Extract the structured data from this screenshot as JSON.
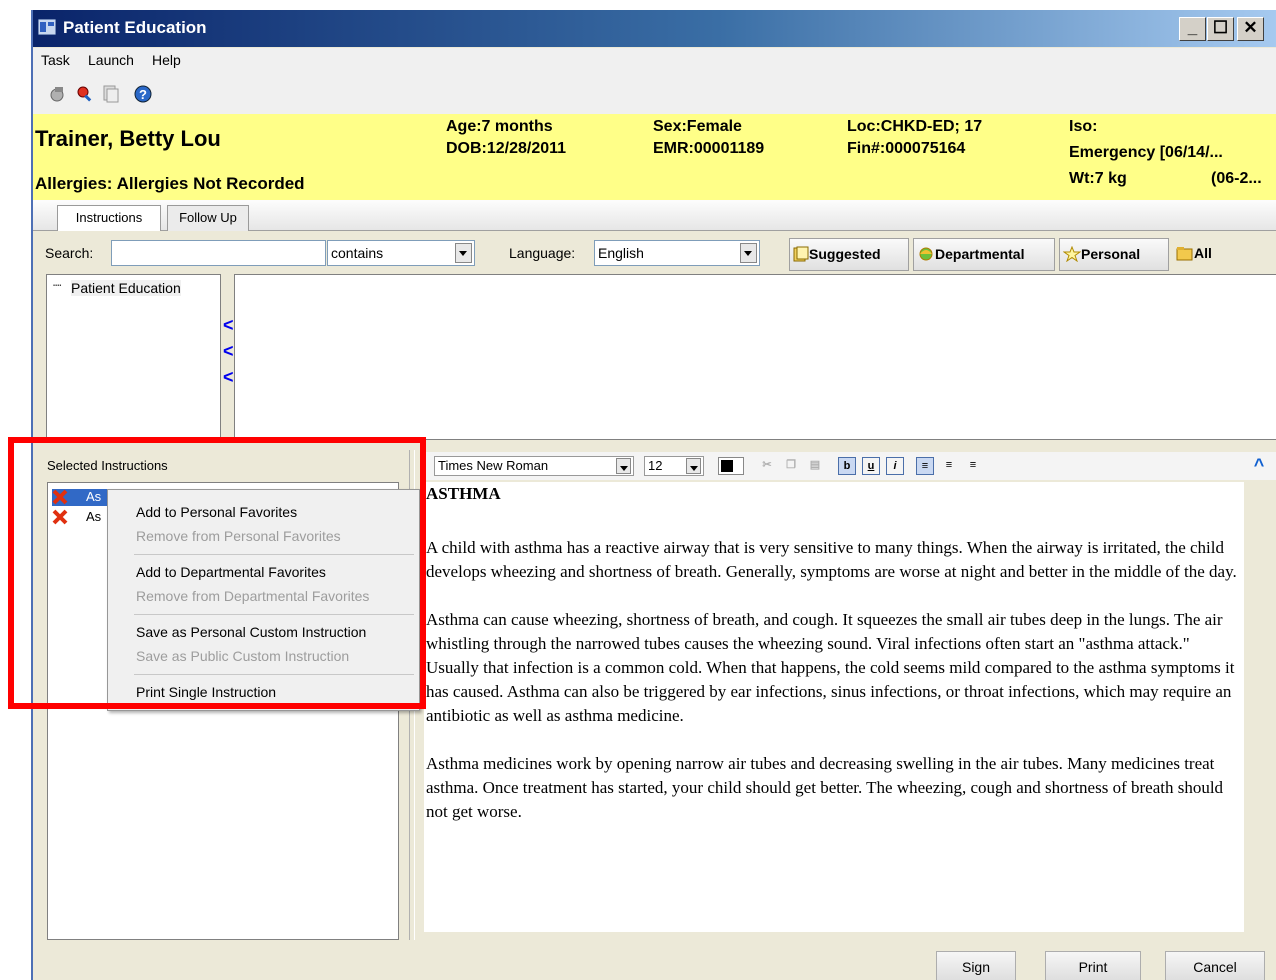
{
  "window": {
    "title": "Patient Education",
    "min_glyph": "_",
    "max_glyph": "☐",
    "close_glyph": "✕"
  },
  "menu": [
    "Task",
    "Launch",
    "Help"
  ],
  "toolbar_icons": [
    "print-icon",
    "search-icon",
    "copy-icon",
    "help-icon"
  ],
  "banner": {
    "name": "Trainer, Betty Lou",
    "allergies": "Allergies: Allergies Not Recorded",
    "age": "Age:7 months",
    "dob": "DOB:12/28/2011",
    "sex": "Sex:Female",
    "emr": "EMR:00001189",
    "loc": "Loc:CHKD-ED; 17",
    "fin": "Fin#:000075164",
    "iso": "Iso:",
    "encounter": "Emergency [06/14/...",
    "weight": "Wt:7 kg",
    "weight_date": "(06-2..."
  },
  "tabs": [
    "Instructions",
    "Follow Up"
  ],
  "search": {
    "label": "Search:",
    "value": "",
    "mode": "contains",
    "language_label": "Language:",
    "language": "English"
  },
  "filters": [
    "Suggested",
    "Departmental",
    "Personal",
    "All"
  ],
  "tree": {
    "root": "Patient Education",
    "arrows": [
      "<",
      "<",
      "<"
    ]
  },
  "selected": {
    "header": "Selected Instructions",
    "items": [
      "As",
      "As"
    ]
  },
  "context_menu": {
    "items": [
      "Add to Personal Favorites",
      "Remove from Personal Favorites",
      "Add to Departmental Favorites",
      "Remove from Departmental Favorites",
      "Save as Personal Custom Instruction",
      "Save as Public Custom Instruction",
      "Print Single Instruction"
    ]
  },
  "editor_toolbar": {
    "font": "Times New Roman",
    "size": "12",
    "bold_glyph": "b",
    "underline_glyph": "u",
    "italic_glyph": "i",
    "collapse_glyph": "^"
  },
  "document": {
    "title": "ASTHMA",
    "paragraphs": [
      "A child with asthma has a reactive airway that is very sensitive to many things. When the airway is irritated, the child develops wheezing and shortness of breath. Generally, symptoms are worse at night and better in the middle of the day.",
      "Asthma can cause wheezing, shortness of breath, and cough. It squeezes the small air tubes deep in the lungs. The air whistling through the narrowed tubes causes the wheezing sound. Viral infections often start an \"asthma attack.\" Usually that infection is a common cold. When that happens, the cold seems mild compared to the asthma symptoms it has caused. Asthma can also be triggered by ear infections, sinus infections, or throat infections, which may require an antibiotic as well as asthma medicine.",
      "Asthma medicines work by opening narrow air tubes and decreasing swelling in the air tubes. Many medicines treat asthma. Once treatment has started, your child should get better. The wheezing, cough and shortness of breath should not get worse."
    ]
  },
  "buttons": [
    "Sign",
    "Print",
    "Cancel"
  ],
  "colors": {
    "banner": "#ffff88",
    "highlight": "#ff0000",
    "title_gradient_start": "#0a246a"
  }
}
